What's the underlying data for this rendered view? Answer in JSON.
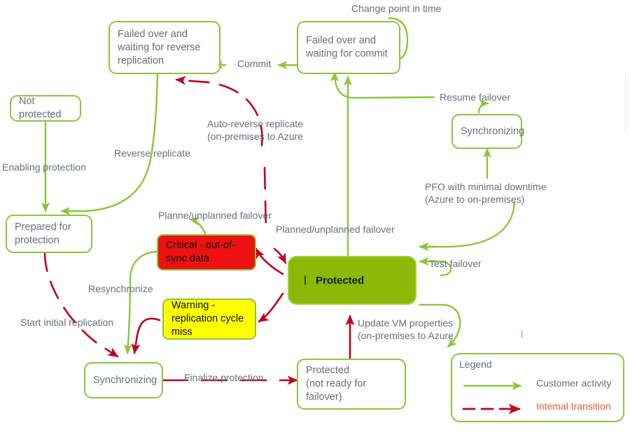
{
  "diagram": {
    "title": "Azure Site Recovery replication state diagram",
    "colors": {
      "customer_activity": "#8cc63e",
      "internal_transition": "#c00020",
      "protected_fill": "#8cb808",
      "critical_fill": "#ee1111",
      "warning_fill": "#ffff00",
      "label_text": "#64707c",
      "internal_text": "#e05c3c",
      "box_border": "#8cc63e",
      "box_fill": "#ffffff"
    }
  },
  "nodes": [
    {
      "id": "failed-over-reverse-replication",
      "label": "Failed over and\nwaiting for reverse\nreplication",
      "style": "plain"
    },
    {
      "id": "failed-over-commit",
      "label": "Failed over and\nwaiting for commit",
      "style": "plain"
    },
    {
      "id": "not-protected",
      "label": "Not protected",
      "style": "plain"
    },
    {
      "id": "prepared-for-protection",
      "label": "Prepared for\nprotection",
      "style": "plain"
    },
    {
      "id": "synchronizing-top",
      "label": "Synchronizing",
      "style": "plain"
    },
    {
      "id": "critical-out-of-sync",
      "label": "Critical - out-of-\nsync data",
      "style": "critical"
    },
    {
      "id": "warning-replication-cycle-miss",
      "label": "Warning -\nreplication cycle\nmiss",
      "style": "warning"
    },
    {
      "id": "protected",
      "label": "Protected",
      "style": "protected"
    },
    {
      "id": "synchronizing-bottom",
      "label": "Synchronizing",
      "style": "plain"
    },
    {
      "id": "protected-not-ready",
      "label": "Protected\n(not ready for\nfailover)",
      "style": "plain"
    }
  ],
  "edge_labels": [
    {
      "id": "change-point-in-time",
      "text": "Change point in time",
      "kind": "customer"
    },
    {
      "id": "commit",
      "text": "Commit",
      "kind": "customer"
    },
    {
      "id": "resume-failover",
      "text": "Resume failover",
      "kind": "customer"
    },
    {
      "id": "auto-reverse-replicate",
      "text": "Auto-reverse replicate\n(on-premises to Azure",
      "kind": "internal"
    },
    {
      "id": "reverse-replicate",
      "text": "Reverse replicate",
      "kind": "customer"
    },
    {
      "id": "enabling-protection",
      "text": "Enabling protection",
      "kind": "customer"
    },
    {
      "id": "pfo-minimal-downtime",
      "text": "PFO with minimal downtime\n(Azure to on-premises)",
      "kind": "customer"
    },
    {
      "id": "planne-unplanned-failover",
      "text": "Planne/unplanned failover",
      "kind": "internal"
    },
    {
      "id": "planned-unplanned-failover",
      "text": "Planned/unplanned failover",
      "kind": "customer"
    },
    {
      "id": "test-failover",
      "text": "Test failover",
      "kind": "customer"
    },
    {
      "id": "resynchronize",
      "text": "Resynchronize",
      "kind": "customer"
    },
    {
      "id": "start-initial-replication",
      "text": "Start initial replication",
      "kind": "internal"
    },
    {
      "id": "update-vm-properties",
      "text": "Update VM properties\n(on-premises to Azure",
      "kind": "internal"
    },
    {
      "id": "finalize-protection",
      "text": "Finalize protection",
      "kind": "internal"
    }
  ],
  "legend": {
    "title": "Legend",
    "items": [
      {
        "id": "customer-activity",
        "label": "Customer activity",
        "line": "solid"
      },
      {
        "id": "internal-transition",
        "label": "Intemal transition",
        "line": "dashed"
      }
    ]
  }
}
